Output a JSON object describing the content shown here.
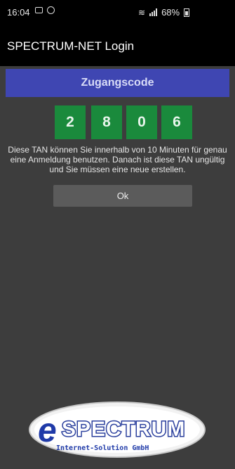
{
  "status_bar": {
    "time": "16:04",
    "battery": "68%"
  },
  "app_bar": {
    "title": "SPECTRUM-NET Login"
  },
  "section": {
    "header": "Zugangscode"
  },
  "code": {
    "digits": [
      "2",
      "8",
      "0",
      "6"
    ]
  },
  "info": {
    "text": "Diese TAN können Sie innerhalb von 10 Minuten für genau eine Anmeldung benutzen. Danach ist diese TAN ungültig und Sie müssen eine neue erstellen."
  },
  "ok_button": {
    "label": "Ok"
  },
  "logo": {
    "letter_e": "e",
    "brand": "SPECTRUM",
    "tagline": "Internet-Solution GmbH"
  },
  "colors": {
    "background": "#3d3d3d",
    "header_blue": "#3f46b2",
    "code_green": "#1a8a3c",
    "button_gray": "#5b5b5b"
  }
}
